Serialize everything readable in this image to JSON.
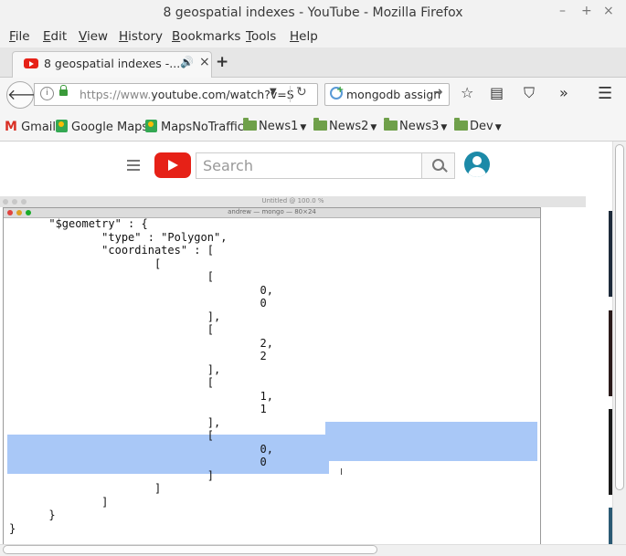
{
  "window": {
    "title": "8 geospatial indexes - YouTube - Mozilla Firefox",
    "controls": [
      "–",
      "+",
      "×"
    ]
  },
  "menu": [
    "File",
    "Edit",
    "View",
    "History",
    "Bookmarks",
    "Tools",
    "Help"
  ],
  "menu_access": [
    "F",
    "E",
    "V",
    "H",
    "B",
    "T",
    "H"
  ],
  "tab": {
    "title": "8 geospatial indexes -...",
    "audio_icon": "speaker-icon",
    "close": "×"
  },
  "newtab": "+",
  "nav": {
    "url_prefix": "https://www.",
    "url_domain": "youtube.com",
    "url_rest": "/watch?v=S",
    "search_value": "mongodb assign"
  },
  "bookmarks": [
    {
      "label": "Gmail",
      "icon": "gmail-icon"
    },
    {
      "label": "Google Maps",
      "icon": "maps-icon"
    },
    {
      "label": "MapsNoTraffic",
      "icon": "maps-icon"
    },
    {
      "label": "News1",
      "icon": "folder-icon"
    },
    {
      "label": "News2",
      "icon": "folder-icon"
    },
    {
      "label": "News3",
      "icon": "folder-icon"
    },
    {
      "label": "Dev",
      "icon": "folder-icon"
    }
  ],
  "youtube": {
    "search_placeholder": "Search",
    "brand_color": "#e62117"
  },
  "video": {
    "outer_window_title": "Untitled @ 100.0 %",
    "terminal_title": "andrew — mongo — 80×24",
    "code": "      \"$geometry\" : {\n              \"type\" : \"Polygon\",\n              \"coordinates\" : [\n                      [\n                              [\n                                      0,\n                                      0\n                              ],\n                              [\n                                      2,\n                                      2\n                              ],\n                              [\n                                      1,\n                                      1\n                              ],\n                              [\n                                      0,\n                                      0\n                              ]\n                      ]\n              ]\n      }\n}",
    "selection_color": "#a9c8f7"
  }
}
